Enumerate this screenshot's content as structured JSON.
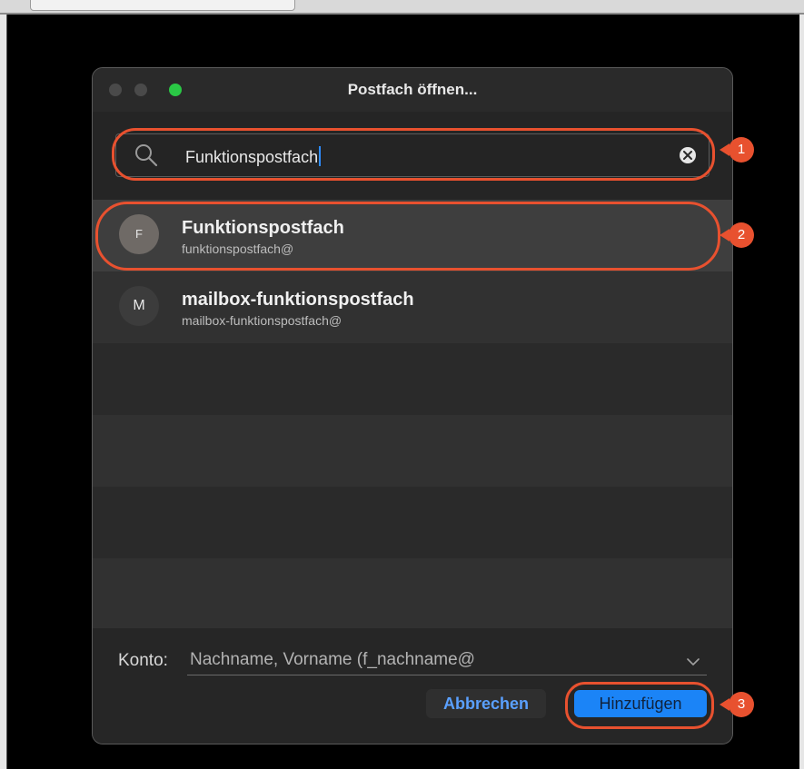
{
  "dialog": {
    "title": "Postfach öffnen...",
    "search": {
      "value": "Funktionspostfach"
    },
    "results": [
      {
        "initial": "F",
        "name": "Funktionspostfach",
        "email": "funktionspostfach@",
        "selected": true
      },
      {
        "initial": "M",
        "name": "mailbox-funktionspostfach",
        "email": "mailbox-funktionspostfach@",
        "selected": false
      }
    ],
    "footer": {
      "konto_label": "Konto:",
      "konto_value": "Nachname, Vorname (f_nachname@",
      "cancel_label": "Abbrechen",
      "add_label": "Hinzufügen"
    }
  },
  "annotations": {
    "step1": "1",
    "step2": "2",
    "step3": "3"
  },
  "colors": {
    "accent": "#1b84f7",
    "annotation": "#e8512f",
    "traffic_green": "#2ac845",
    "background": "#000000"
  },
  "icons": [
    "search-icon",
    "clear-icon",
    "chevron-down-icon"
  ]
}
